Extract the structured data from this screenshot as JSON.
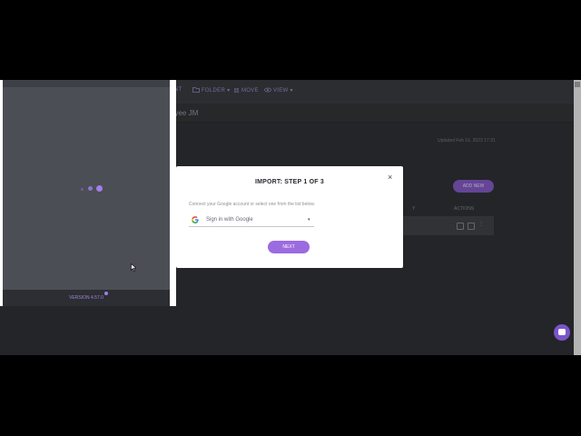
{
  "toolbar": {
    "partial_label": "NT",
    "folder_label": "FOLDER",
    "move_label": "MOVE",
    "view_label": "VIEW"
  },
  "breadcrumb": "oyee JM",
  "updated_text": "Updated Feb 16, 2023 17:31",
  "add_new_label": "ADD NEW",
  "table": {
    "columns": [
      "Y",
      "ACTIONS"
    ]
  },
  "panel": {
    "version_text": "VERSION 4.57.0"
  },
  "modal": {
    "title": "IMPORT: STEP 1 OF 3",
    "close_glyph": "×",
    "description": "Connect your Google account or select one from the list below.",
    "select_value": "Sign in with Google",
    "select_caret": "▾",
    "next_label": "NEXT"
  },
  "colors": {
    "accent": "#9b6be0",
    "app_bg": "#2c2e31",
    "modal_bg": "#ffffff"
  },
  "icons": [
    "folder-icon",
    "move-icon",
    "eye-icon",
    "google-icon",
    "close-icon",
    "chat-icon"
  ]
}
